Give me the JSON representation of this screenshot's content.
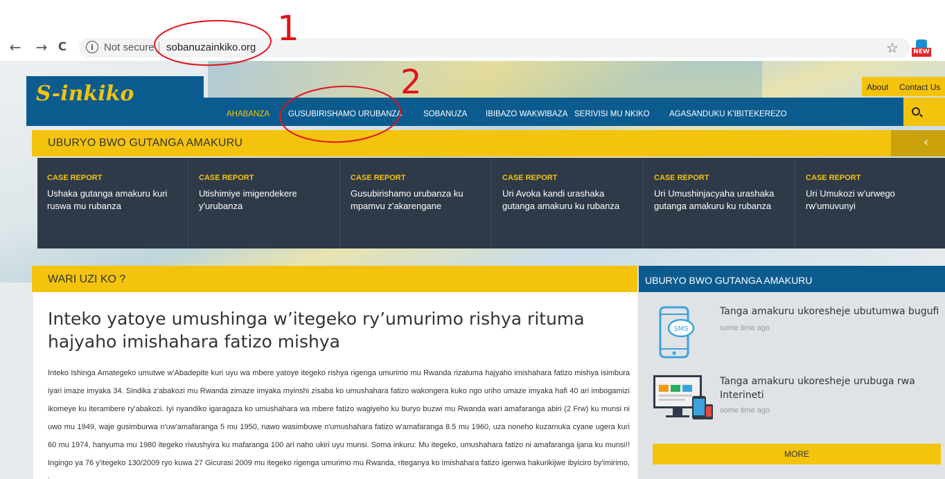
{
  "browser": {
    "security_label": "Not secure",
    "url": "sobanuzainkiko.org",
    "back_glyph": "←",
    "forward_glyph": "→",
    "reload_glyph": "C",
    "info_glyph": "i",
    "star_glyph": "☆",
    "extension_badge": "NEW"
  },
  "annotations": {
    "one": "1",
    "two": "2",
    "color": "#e0141e"
  },
  "site": {
    "logo": "S-inkiko",
    "nav": [
      "AHABANZA",
      "GUSUBIRISHAMO URUBANZA",
      "SOBANUZA",
      "IBIBAZO WAKWIBAZA",
      "SERIVISI MU NKIKO",
      "AGASANDUKU K'IBITEKEREZO"
    ],
    "util_links": [
      "About",
      "Contact Us"
    ],
    "banner_title": "UBURYO BWO GUTANGA AMAKURU",
    "banner_arrow": "‹",
    "cases": [
      {
        "category": "CASE REPORT",
        "title": "Ushaka gutanga amakuru kuri ruswa mu rubanza"
      },
      {
        "category": "CASE REPORT",
        "title": "Utishimiye imigendekere y'urubanza"
      },
      {
        "category": "CASE REPORT",
        "title": "Gusubirishamo urubanza ku mpamvu z'akarengane"
      },
      {
        "category": "CASE REPORT",
        "title": "Uri Avoka kandi urashaka gutanga amakuru ku rubanza"
      },
      {
        "category": "CASE REPORT",
        "title": "Uri Umushinjacyaha urashaka gutanga amakuru ku rubanza"
      },
      {
        "category": "CASE REPORT",
        "title": "Uri Umukozi w'urwego rw'umuvunyi"
      }
    ],
    "section_title": "WARI UZI KO ?",
    "article": {
      "title": "Inteko yatoye umushinga w’itegeko ry’umurimo rishya rituma hajyaho imishahara fatizo mishya",
      "body": "Inteko Ishinga Amategeko umutwe w'Abadepite kuri uyu wa mbere yatoye itegeko rishya rigenga umurimo mu Rwanda rizatuma hajyaho imishahara fatizo mishya isimbura iyari imaze imyaka 34. Sindika z'abakozi mu Rwanda zimaze imyaka myinshi zisaba ko umushahara fatizo wakongera kuko ngo uriho umaze imyaka hafi 40 ari imbogamizi ikomeye ku iterambere ry'abakozi. Iyi nyandiko igaragaza ko umushahara wa mbere fatizo wagiyeho ku buryo buzwi mu Rwanda wari amafaranga abiri (2 Frw) ku munsi ni uwo mu 1949, waje gusimburwa n'uw'amafaranga 5 mu 1950, nawo wasimbuwe n'umushahara fatizo w'amafaranga 8.5 mu 1960, uza noneho kuzamuka cyane ugera kuri 60 mu 1974, hanyuma mu 1980 itegeko riwushyira ku mafaranga 100 ari naho ukiri uyu munsi. Soma inkuru: Mu itegeko, umushahara fatizo ni amafaranga ijana ku munsi!! Ingingo ya 76 y'itegeko 130/2009 ryo kuwa 27 Gicurasi 2009 mu itegeko rigenga umurimo mu Rwanda, riteganya ko imishahara fatizo igenwa hakurikijwe ibyiciro by'imirimo, igenwa"
    },
    "sidebar": {
      "title": "UBURYO BWO GUTANGA AMAKURU",
      "items": [
        {
          "title": "Tanga amakuru ukoresheje ubutumwa bugufi",
          "time": "some time ago",
          "icon": "sms-phone-icon",
          "icon_text": "SMS"
        },
        {
          "title": "Tanga amakuru ukoresheje urubuga rwa Interineti",
          "time": "some time ago",
          "icon": "devices-icon"
        }
      ],
      "more_label": "MORE"
    }
  },
  "colors": {
    "brand_blue": "#0c5b8f",
    "brand_yellow": "#f3c30e",
    "dark_panel": "#2f3a48"
  }
}
